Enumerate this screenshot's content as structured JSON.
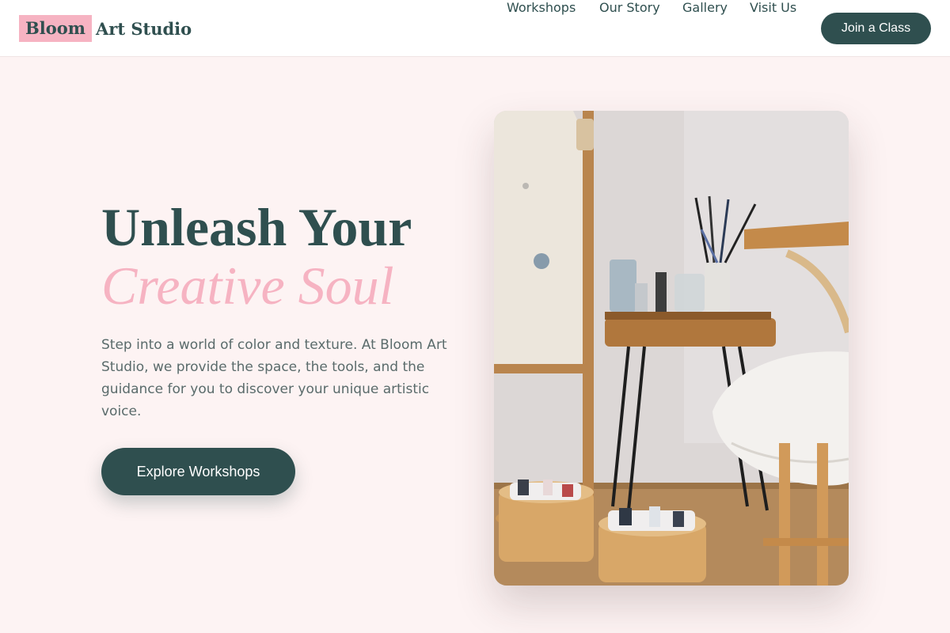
{
  "brand": {
    "highlight": "Bloom",
    "rest": "Art Studio"
  },
  "nav": {
    "links": [
      "Workshops",
      "Our Story",
      "Gallery",
      "Visit Us"
    ],
    "cta_label": "Join a Class"
  },
  "hero": {
    "title_line1": "Unleash Your",
    "title_line2": "Creative Soul",
    "description": "Step into a world of color and texture. At Bloom Art Studio, we provide the space, the tools, and the guidance for you to discover your unique artistic voice.",
    "cta_label": "Explore Workshops"
  },
  "photo": {
    "subject": "art studio still life with easel, brushes, paint tubes and wooden stool"
  },
  "colors": {
    "primary": "#2f4f4f",
    "accent": "#f6b3c2",
    "background": "#fdf3f3"
  }
}
